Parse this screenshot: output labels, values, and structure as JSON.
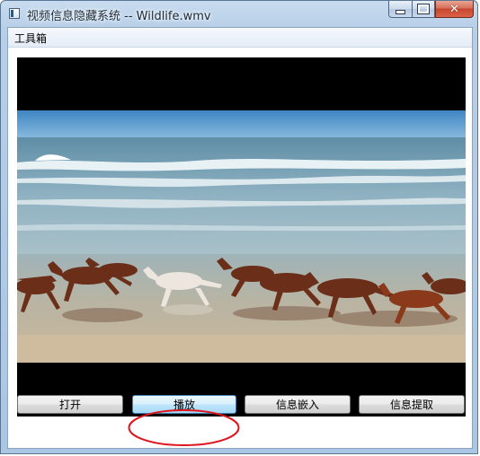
{
  "window": {
    "title": "视频信息隐藏系统 -- Wildlife.wmv",
    "close_symbol": "✕"
  },
  "menu": {
    "items": [
      "工具箱"
    ]
  },
  "video": {
    "file": "Wildlife.wmv"
  },
  "buttons": {
    "open": "打开",
    "play": "播放",
    "embed": "信息嵌入",
    "extract": "信息提取"
  },
  "annotation": {
    "color": "#e0141c",
    "target": "play-button"
  },
  "colors": {
    "sky": "#4a90c9",
    "sea": "#7fa9bd",
    "sand": "#c7b59a",
    "horse": "#6b2e18"
  }
}
